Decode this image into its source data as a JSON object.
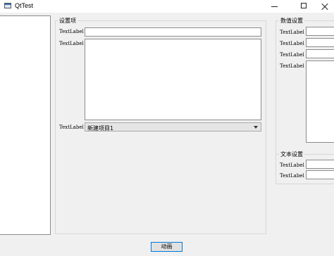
{
  "window": {
    "title": "QtTest"
  },
  "settings_group": {
    "title": "设置项",
    "line_label": "TextLabel",
    "text_label": "TextLabel",
    "combo_label": "TextLabel",
    "combo_value": "新建项目1"
  },
  "number_group": {
    "title": "数值设置",
    "labels": [
      "TextLabel",
      "TextLabel",
      "TextLabel",
      "TextLabel"
    ]
  },
  "text_group": {
    "title": "文本设置",
    "labels": [
      "TextLabel",
      "TextLabel"
    ]
  },
  "action_button": {
    "label": "动画"
  }
}
